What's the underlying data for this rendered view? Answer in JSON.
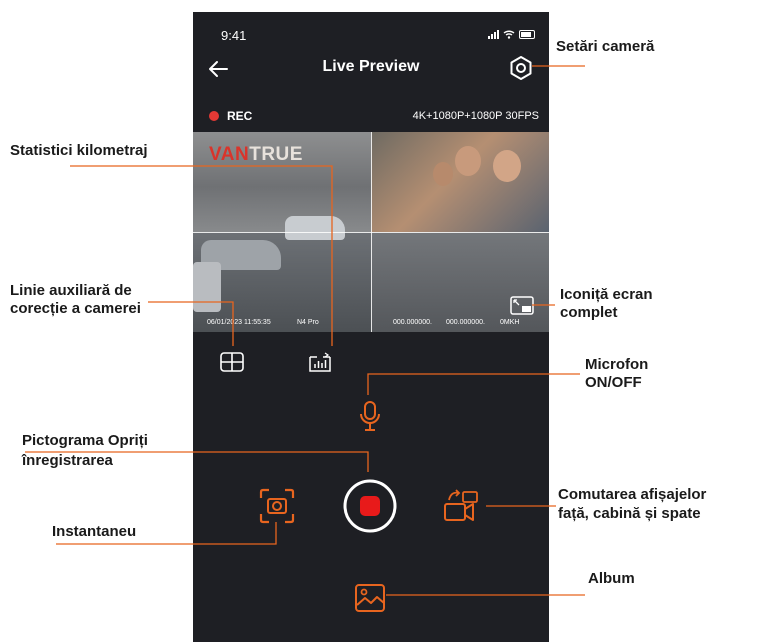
{
  "status_bar": {
    "time": "9:41"
  },
  "header": {
    "title": "Live Preview"
  },
  "recording": {
    "indicator": "REC",
    "resolution": "4K+1080P+1080P 30FPS"
  },
  "preview": {
    "logo_a": "VAN",
    "logo_b": "TRUE",
    "overlay_datetime": "06/01/2023 11:55:35",
    "overlay_model": "N4 Pro",
    "overlay_lat": "000.000000.",
    "overlay_lon": "000.000000.",
    "overlay_speed": "0MKH"
  },
  "annotations": {
    "settings": "Setări cameră",
    "stats": "Statistici kilometraj",
    "grid_line1": "Linie auxiliară de",
    "grid_line2": "corecție a camerei",
    "fullscreen_line1": "Iconiță ecran",
    "fullscreen_line2": "complet",
    "mic_line1": "Microfon",
    "mic_line2": "ON/OFF",
    "stop_line1": "Pictograma Opriți",
    "stop_line2": "înregistrarea",
    "snapshot": "Instantaneu",
    "switch_line1": "Comutarea afișajelor",
    "switch_line2": "față, cabină și spate",
    "album": "Album"
  },
  "colors": {
    "accent": "#e8651f",
    "record": "#e81a1a",
    "background": "#1e1f24",
    "callout_line": "#e8651f"
  },
  "icons": [
    "back-arrow-icon",
    "gear-icon",
    "grid-icon",
    "stats-icon",
    "fullscreen-icon",
    "microphone-icon",
    "camera-snapshot-icon",
    "record-stop-icon",
    "switch-camera-icon",
    "album-icon"
  ]
}
